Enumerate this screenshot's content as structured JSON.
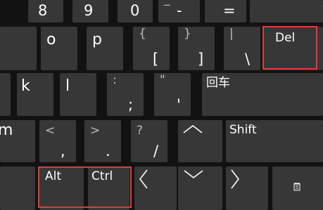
{
  "keys": {
    "digit8": "8",
    "digit9": "9",
    "digit0": "0",
    "minus": {
      "top": "_",
      "main": "-"
    },
    "equals": "=",
    "o": "o",
    "p": "p",
    "lbracket": {
      "top": "{",
      "main": "["
    },
    "rbracket": {
      "top": "}",
      "main": "]"
    },
    "backslash": {
      "top": "|",
      "main": "\\"
    },
    "del": "Del",
    "k": "k",
    "l": "l",
    "semicolon": {
      "top": ":",
      "main": ";"
    },
    "quote": {
      "top": "\"",
      "main": "'"
    },
    "enter": "回车",
    "m": "m",
    "comma": {
      "top": "<",
      "main": ","
    },
    "period": {
      "top": ">",
      "main": "."
    },
    "slash": {
      "top": "?",
      "main": "/"
    },
    "shift": "Shift",
    "alt": "Alt",
    "ctrl": "Ctrl"
  },
  "icons": [
    "arrow-up-icon",
    "arrow-left-icon",
    "arrow-down-icon",
    "arrow-right-icon",
    "keyboard-settings-icon"
  ],
  "colors": {
    "background": "#121212",
    "key": "#373737",
    "highlight": "#e23a3a",
    "secondary_text": "#bdbdbd"
  }
}
